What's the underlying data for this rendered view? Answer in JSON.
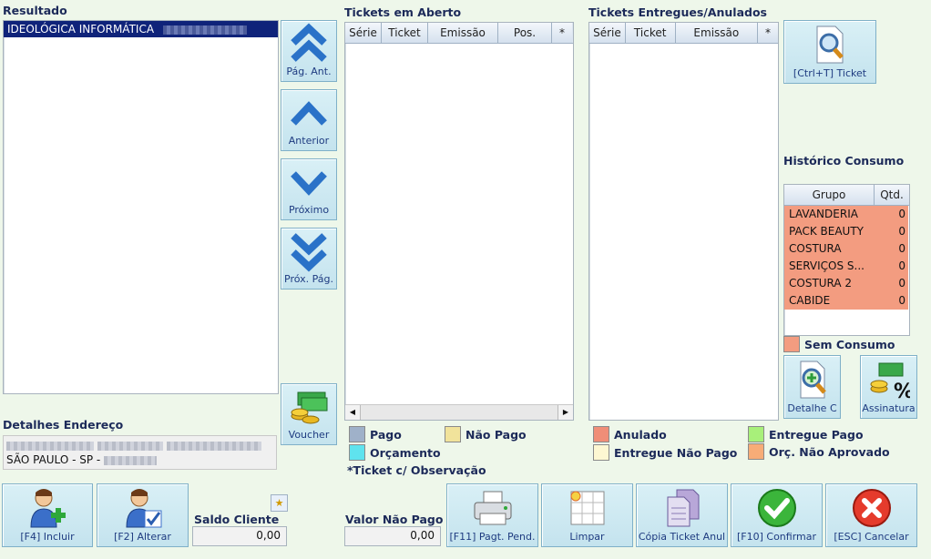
{
  "result": {
    "title": "Resultado",
    "rows": [
      "IDEOLÓGICA INFORMÁTICA"
    ]
  },
  "nav": {
    "prev_page": "Pág. Ant.",
    "previous": "Anterior",
    "next": "Próximo",
    "next_page": "Próx. Pág.",
    "voucher": "Voucher"
  },
  "open_tickets": {
    "title": "Tickets em Aberto",
    "columns": [
      "Série",
      "Ticket",
      "Emissão",
      "Pos.",
      "*"
    ]
  },
  "delivered_tickets": {
    "title": "Tickets Entregues/Anulados",
    "columns": [
      "Série",
      "Ticket",
      "Emissão",
      "*"
    ]
  },
  "ticket_search": {
    "label": "[Ctrl+T] Ticket"
  },
  "history": {
    "title": "Histórico Consumo",
    "columns": [
      "Grupo",
      "Qtd."
    ],
    "rows": [
      {
        "group": "LAVANDERIA",
        "qty": "0"
      },
      {
        "group": "PACK BEAUTY",
        "qty": "0"
      },
      {
        "group": "COSTURA",
        "qty": "0"
      },
      {
        "group": "SERVIÇOS  S...",
        "qty": "0"
      },
      {
        "group": "COSTURA 2",
        "qty": "0"
      },
      {
        "group": "CABIDE",
        "qty": "0"
      }
    ],
    "legend": "Sem Consumo",
    "detail_button": "Detalhe C",
    "signature_button": "Assinatura"
  },
  "address": {
    "title": "Detalhes Endereço",
    "line2": "SÃO PAULO - SP - "
  },
  "legend_open": {
    "paid": "Pago",
    "unpaid": "Não Pago",
    "quote": "Orçamento",
    "note": "*Ticket c/ Observação"
  },
  "legend_delivered": {
    "cancelled": "Anulado",
    "delivered_unpaid": "Entregue Não Pago",
    "delivered_paid": "Entregue Pago",
    "quote_not_approved": "Orç. Não Aprovado"
  },
  "colors": {
    "paid": "#9fb1c9",
    "unpaid": "#f1e39b",
    "quote": "#5fe3ee",
    "cancelled": "#f08e78",
    "delivered_unpaid": "#fdf7d2",
    "delivered_paid": "#a8f07a",
    "quote_not_approved": "#f7ac77",
    "no_consumption": "#f39c80"
  },
  "footer": {
    "include": "[F4] Incluir",
    "edit": "[F2] Alterar",
    "balance_label": "Saldo Cliente",
    "balance_value": "0,00",
    "unpaid_label": "Valor Não Pago",
    "unpaid_value": "0,00",
    "pending_payment": "[F11] Pagt. Pend.",
    "clear": "Limpar",
    "copy_cancelled": "Cópia Ticket Anul",
    "confirm": "[F10] Confirmar",
    "cancel": "[ESC] Cancelar"
  }
}
